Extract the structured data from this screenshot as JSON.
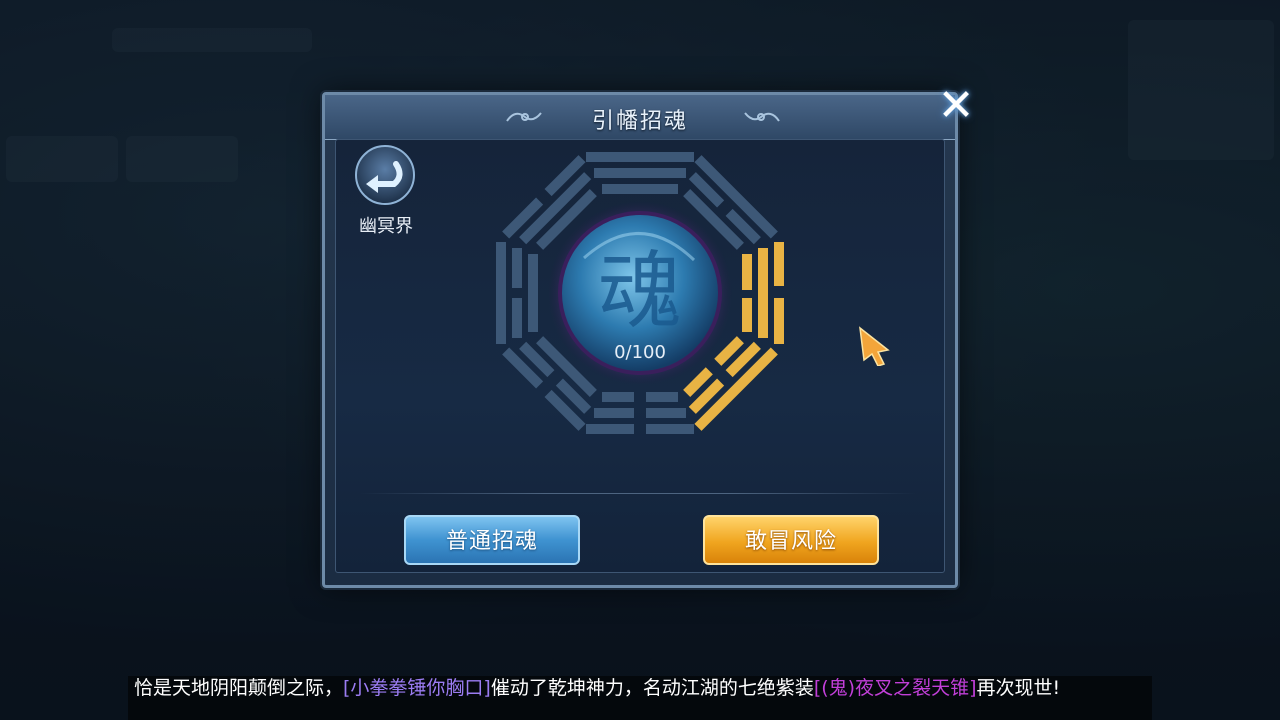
{
  "dialog": {
    "title": "引幡招魂",
    "back_label": "幽冥界",
    "progress": "0/100",
    "emblem_char": "魂",
    "btn_normal": "普通招魂",
    "btn_risk": "敢冒风险",
    "close_icon": "close-icon"
  },
  "ticker": {
    "prefix": "恰是天地阴阳颠倒之际，",
    "player": "[小拳拳锤你胸口]",
    "middle": "催动了乾坤神力，名动江湖的七绝紫装",
    "item": "[(鬼)夜叉之裂天锥]",
    "suffix": "再次现世!"
  },
  "colors": {
    "trigram_lit": "#e8b344",
    "trigram_dim": "#3d5877",
    "player_name": "#9b7cf2",
    "item_name": "#c13fd8",
    "button_blue": "#3f93d1",
    "button_gold": "#f0a51f"
  }
}
